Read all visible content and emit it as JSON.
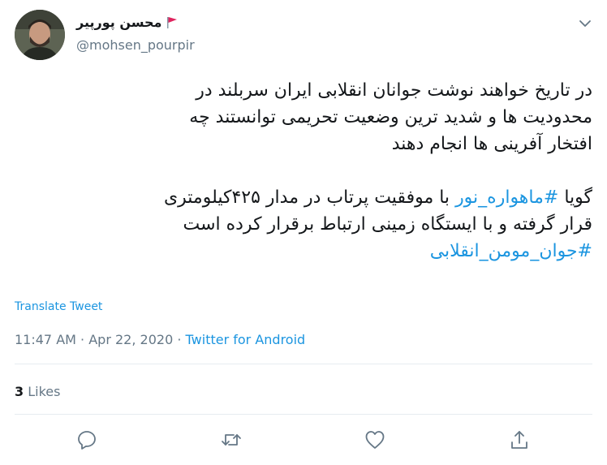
{
  "user": {
    "display_name": "محسن پورپیر",
    "handle": "@mohsen_pourpir",
    "flag_color": "#e0245e"
  },
  "tweet": {
    "para1_line1": "در تاریخ خواهند نوشت جوانان انقلابی ایران سربلند در",
    "para1_line2": "محدودیت ها و شدید ترین وضعیت  تحریمی توانستند چه",
    "para1_line3": "افتخار آفرینی ها انجام دهند",
    "para2_prefix": "گویا",
    "hashtag1": "#ماهواره_نور",
    "para2_suffix": "با موفقیت پرتاب در مدار  ۴۲۵کیلومتری",
    "para2_line2": "قرار گرفته و با ایستگاه زمینی ارتباط برقرار کرده است",
    "hashtag2": "#جوان_مومن_انقلابی"
  },
  "translate_label": "Translate Tweet",
  "meta": {
    "time": "11:47 AM",
    "sep1": "·",
    "date": "Apr 22, 2020",
    "sep2": "·",
    "source": "Twitter for Android"
  },
  "likes": {
    "count": "3",
    "label": "Likes"
  },
  "icons": {
    "menu": "chevron-down-icon",
    "reply": "reply-icon",
    "retweet": "retweet-icon",
    "like": "heart-icon",
    "share": "share-icon"
  },
  "colors": {
    "accent": "#1b95e0",
    "muted": "#657786",
    "text": "#14171a"
  }
}
